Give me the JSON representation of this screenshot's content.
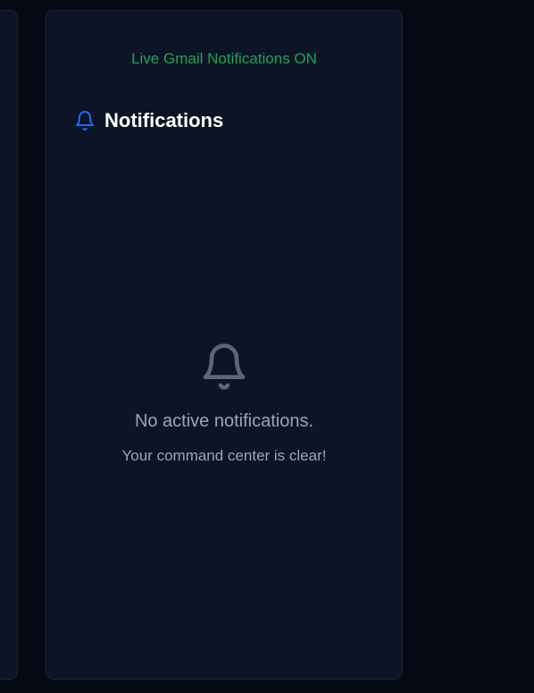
{
  "status": {
    "live_text": "Live Gmail Notifications ON",
    "color": "#22a355"
  },
  "notifications": {
    "title": "Notifications",
    "header_icon": "bell-icon",
    "accent_color": "#1e6bff",
    "empty": {
      "icon": "bell-outline-icon",
      "title": "No active notifications.",
      "subtitle": "Your command center is clear!"
    }
  }
}
